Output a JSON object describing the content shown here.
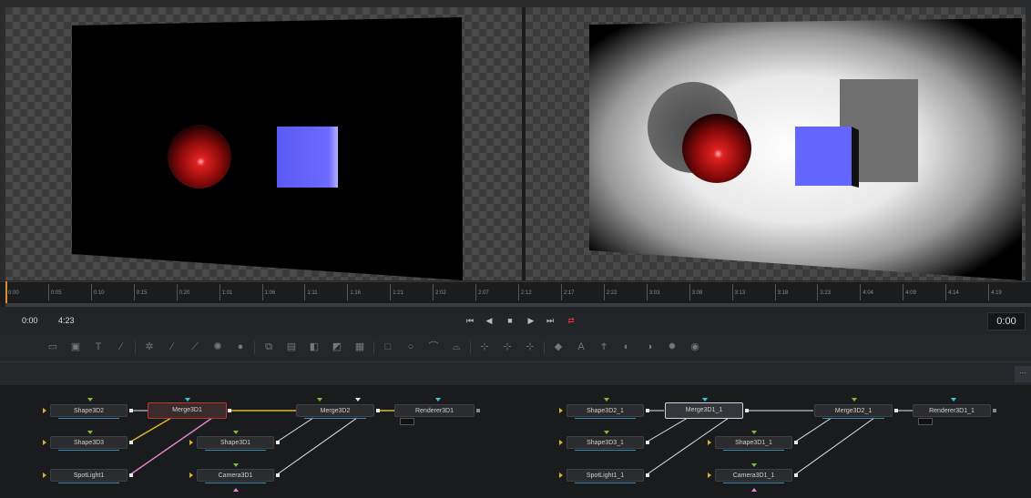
{
  "timeline": {
    "ticks": [
      "0:00",
      "0:05",
      "0:10",
      "0:15",
      "0:20",
      "1:01",
      "1:06",
      "1:11",
      "1:16",
      "1:21",
      "2:02",
      "2:07",
      "2:12",
      "2:17",
      "2:22",
      "3:03",
      "3:08",
      "3:13",
      "3:18",
      "3:23",
      "4:04",
      "4:09",
      "4:14",
      "4:19"
    ],
    "playhead_fraction": 0.0
  },
  "transport": {
    "start_time": "0:00",
    "end_time": "4:23",
    "current_time": "0:00",
    "buttons": [
      "skip-to-start-icon",
      "step-back-icon",
      "stop-icon",
      "play-icon",
      "skip-to-end-icon",
      "loop-icon"
    ]
  },
  "toolbar": {
    "tools": [
      "background-icon",
      "image-plane-icon",
      "text-icon",
      "paint-icon",
      "particles-icon",
      "mask-icon",
      "polygon-icon",
      "brightness-icon",
      "blur-icon",
      "merge-icon",
      "transform-icon",
      "channel-booleans-icon",
      "color-corrector-icon",
      "resize-icon",
      "rectangle-mask-icon",
      "ellipse-mask-icon",
      "polygon-mask-icon",
      "bspline-mask-icon",
      "tracker-icon",
      "planar-tracker-icon",
      "keyer-icon",
      "shape3d-icon",
      "text3d-icon",
      "merge3d-icon",
      "camera3d-icon",
      "renderer3d-icon",
      "light-icon",
      "fbx-icon"
    ]
  },
  "flow_left": {
    "nodes": {
      "shape3d2": "Shape3D2",
      "merge3d1": "Merge3D1",
      "merge3d2": "Merge3D2",
      "renderer3d1": "Renderer3D1",
      "shape3d3": "Shape3D3",
      "shape3d1": "Shape3D1",
      "spotlight1": "SpotLight1",
      "camera3d1": "Camera3D1"
    }
  },
  "flow_right": {
    "nodes": {
      "shape3d2_1": "Shape3D2_1",
      "merge3d1_1": "Merge3D1_1",
      "merge3d2_1": "Merge3D2_1",
      "renderer3d1_1": "Renderer3D1_1",
      "shape3d3_1": "Shape3D3_1",
      "shape3d1_1": "Shape3D1_1",
      "spotlight1_1": "SpotLight1_1",
      "camera3d1_1": "Camera3D1_1"
    }
  },
  "colors": {
    "playhead": "#e08a2c",
    "loop_active": "#e03a4a",
    "link_yellow": "#e0b72a",
    "link_pink": "#e486d2",
    "link_white": "#e6e6e6",
    "node_selected": "#c0352b",
    "sphere": "#b01010",
    "cube": "#6464ff"
  }
}
